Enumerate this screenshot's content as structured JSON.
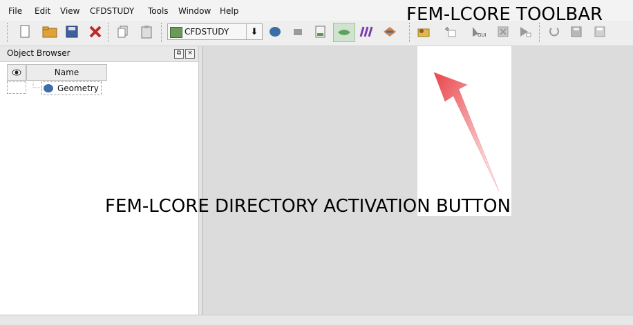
{
  "menubar": {
    "items": [
      {
        "label": "File"
      },
      {
        "label": "Edit"
      },
      {
        "label": "View"
      },
      {
        "label": "CFDSTUDY"
      },
      {
        "label": "Tools"
      },
      {
        "label": "Window"
      },
      {
        "label": "Help"
      }
    ]
  },
  "toolbar": {
    "module_combo": {
      "value": "CFDSTUDY"
    },
    "icons": [
      "new-document",
      "open-folder",
      "save-disk",
      "close-x",
      "copy-page",
      "paste-page",
      "geometry-module",
      "mesh-module",
      "post-module",
      "active-module",
      "paravis-module",
      "other-module",
      "fem-lcore-directory",
      "fem-lcore-add",
      "fem-lcore-gui",
      "fem-lcore-stop",
      "fem-lcore-run",
      "fem-lcore-reload",
      "fem-lcore-save",
      "fem-lcore-save-as"
    ]
  },
  "object_browser": {
    "title": "Object Browser",
    "columns": {
      "visibility_icon": "eye-icon",
      "name": "Name"
    },
    "items": [
      {
        "name": "Geometry",
        "icon": "geometry-icon"
      }
    ]
  },
  "annotations": {
    "toolbar_label": "FEM-LCORE TOOLBAR",
    "button_label": "FEM-LCORE DIRECTORY ACTIVATION BUTTON"
  },
  "colors": {
    "arrow": "#e8454b",
    "panel_white": "#ffffff",
    "viewer_bg": "#dcdcdc"
  }
}
